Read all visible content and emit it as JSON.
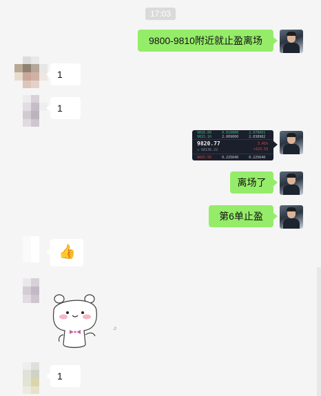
{
  "chat": {
    "timestamp": "17:03",
    "messages": [
      {
        "side": "out",
        "type": "text",
        "text": "9800-9810附近就止盈离场"
      },
      {
        "side": "in",
        "type": "text",
        "text": "1"
      },
      {
        "side": "in",
        "type": "text",
        "text": "1"
      },
      {
        "side": "out",
        "type": "image",
        "image": {
          "rows_top": [
            "9816.00",
            "0.010000",
            "2.078001",
            "9815.16",
            "2.009000",
            "2.038982"
          ],
          "price": "9820.77",
          "sub": "≈ 68136.22",
          "pct": "3.41%",
          "chg": "+323.53",
          "rows_bottom": [
            "9815.55",
            "0.225640",
            "0.225640"
          ]
        }
      },
      {
        "side": "out",
        "type": "text",
        "text": "离场了"
      },
      {
        "side": "out",
        "type": "text",
        "text": "第6单止盈"
      },
      {
        "side": "in",
        "type": "emoji",
        "emoji": "👍"
      },
      {
        "side": "in",
        "type": "sticker",
        "sticker": "cute-bear-sticker"
      },
      {
        "side": "in",
        "type": "text",
        "text": "1"
      }
    ]
  },
  "colors": {
    "background": "#f5f5f5",
    "outgoing_bubble": "#95ec69",
    "incoming_bubble": "#ffffff",
    "timestamp_pill": "#dadada"
  }
}
